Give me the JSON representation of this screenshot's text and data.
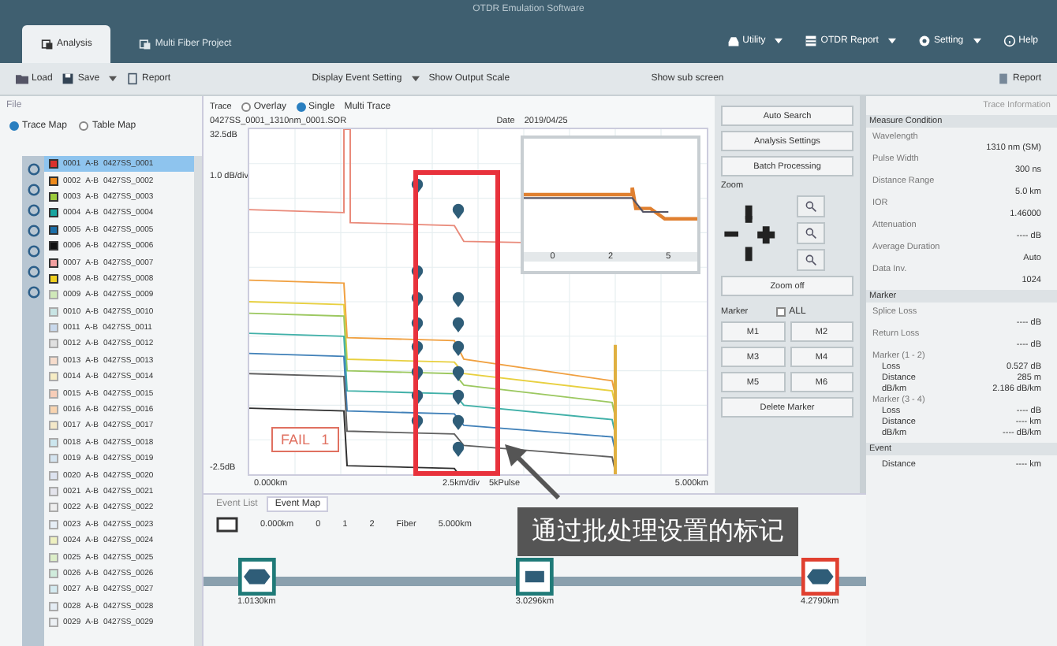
{
  "window": {
    "title": "OTDR Emulation Software"
  },
  "ribbon_tabs": [
    {
      "label": "Analysis",
      "selected": true
    },
    {
      "label": "Multi Fiber Project",
      "selected": false
    }
  ],
  "ribbon_buttons": [
    {
      "label": "Utility",
      "kind": "drive"
    },
    {
      "label": "OTDR Report",
      "kind": "table"
    },
    {
      "label": "Setting",
      "kind": "gear"
    },
    {
      "label": "Help",
      "kind": "help"
    }
  ],
  "toolbar": {
    "load": "Load",
    "save": "Save",
    "report": "Report",
    "display": "Display Event Setting",
    "scale": "Show Output Scale",
    "sub": "Show sub screen",
    "report_right": "Report"
  },
  "left_panel": {
    "title": "File",
    "modes": [
      {
        "label": "Trace Map",
        "selected": true
      },
      {
        "label": "Table Map",
        "selected": false
      }
    ],
    "files": [
      {
        "num": "0001",
        "dir": "A-B",
        "name": "0427SS_0001",
        "color": "#d9302c",
        "checked": true,
        "selected": true
      },
      {
        "num": "0002",
        "dir": "A-B",
        "name": "0427SS_0002",
        "color": "#ee8a1c",
        "checked": true,
        "selected": false
      },
      {
        "num": "0003",
        "dir": "A-B",
        "name": "0427SS_0003",
        "color": "#9ccc3c",
        "checked": true,
        "selected": false
      },
      {
        "num": "0004",
        "dir": "A-B",
        "name": "0427SS_0004",
        "color": "#1aa5a0",
        "checked": true,
        "selected": false
      },
      {
        "num": "0005",
        "dir": "A-B",
        "name": "0427SS_0005",
        "color": "#1c6fa8",
        "checked": true,
        "selected": false
      },
      {
        "num": "0006",
        "dir": "A-B",
        "name": "0427SS_0006",
        "color": "#111111",
        "checked": true,
        "selected": false
      },
      {
        "num": "0007",
        "dir": "A-B",
        "name": "0427SS_0007",
        "color": "#f2a0a0",
        "checked": true,
        "selected": false
      },
      {
        "num": "0008",
        "dir": "A-B",
        "name": "0427SS_0008",
        "color": "#f0d020",
        "checked": true,
        "selected": false
      },
      {
        "num": "0009",
        "dir": "A-B",
        "name": "0427SS_0009",
        "color": "#cfe8b8",
        "checked": false,
        "selected": false
      },
      {
        "num": "0010",
        "dir": "A-B",
        "name": "0427SS_0010",
        "color": "#c8e4e4",
        "checked": false,
        "selected": false
      },
      {
        "num": "0011",
        "dir": "A-B",
        "name": "0427SS_0011",
        "color": "#c8d8ec",
        "checked": false,
        "selected": false
      },
      {
        "num": "0012",
        "dir": "A-B",
        "name": "0427SS_0012",
        "color": "#e0e0e0",
        "checked": false,
        "selected": false
      },
      {
        "num": "0013",
        "dir": "A-B",
        "name": "0427SS_0013",
        "color": "#f6dccc",
        "checked": false,
        "selected": false
      },
      {
        "num": "0014",
        "dir": "A-B",
        "name": "0427SS_0014",
        "color": "#f6ecc4",
        "checked": false,
        "selected": false
      },
      {
        "num": "0015",
        "dir": "A-B",
        "name": "0427SS_0015",
        "color": "#f7cdb8",
        "checked": false,
        "selected": false
      },
      {
        "num": "0016",
        "dir": "A-B",
        "name": "0427SS_0016",
        "color": "#f8d4b0",
        "checked": false,
        "selected": false
      },
      {
        "num": "0017",
        "dir": "A-B",
        "name": "0427SS_0017",
        "color": "#f4e8c8",
        "checked": false,
        "selected": false
      },
      {
        "num": "0018",
        "dir": "A-B",
        "name": "0427SS_0018",
        "color": "#cce6ee",
        "checked": false,
        "selected": false
      },
      {
        "num": "0019",
        "dir": "A-B",
        "name": "0427SS_0019",
        "color": "#d4e4f0",
        "checked": false,
        "selected": false
      },
      {
        "num": "0020",
        "dir": "A-B",
        "name": "0427SS_0020",
        "color": "#dde3f0",
        "checked": false,
        "selected": false
      },
      {
        "num": "0021",
        "dir": "A-B",
        "name": "0427SS_0021",
        "color": "#e4e4ec",
        "checked": false,
        "selected": false
      },
      {
        "num": "0022",
        "dir": "A-B",
        "name": "0427SS_0022",
        "color": "#eeeeee",
        "checked": false,
        "selected": false
      },
      {
        "num": "0023",
        "dir": "A-B",
        "name": "0427SS_0023",
        "color": "#e6eef6",
        "checked": false,
        "selected": false
      },
      {
        "num": "0024",
        "dir": "A-B",
        "name": "0427SS_0024",
        "color": "#eef0c0",
        "checked": false,
        "selected": false
      },
      {
        "num": "0025",
        "dir": "A-B",
        "name": "0427SS_0025",
        "color": "#dceec8",
        "checked": false,
        "selected": false
      },
      {
        "num": "0026",
        "dir": "A-B",
        "name": "0427SS_0026",
        "color": "#d0ecdc",
        "checked": false,
        "selected": false
      },
      {
        "num": "0027",
        "dir": "A-B",
        "name": "0427SS_0027",
        "color": "#d4eaf0",
        "checked": false,
        "selected": false
      },
      {
        "num": "0028",
        "dir": "A-B",
        "name": "0427SS_0028",
        "color": "#e4ecf4",
        "checked": false,
        "selected": false
      },
      {
        "num": "0029",
        "dir": "A-B",
        "name": "0427SS_0029",
        "color": "#ecf0f4",
        "checked": false,
        "selected": false
      }
    ]
  },
  "trace_panel": {
    "label": "Trace",
    "views": [
      {
        "label": "Overlay",
        "selected": false
      },
      {
        "label": "Single",
        "selected": true
      }
    ],
    "multi": "Multi Trace",
    "file": "0427SS_0001_1310nm_0001.SOR",
    "date_label": "Date",
    "date": "2019/04/25",
    "y_top": "32.5dB",
    "y_div": "1.0 dB/div",
    "y_bottom": "-2.5dB",
    "x_left": "0.000km",
    "x_mid": "2.5km/div",
    "x_mid2": "5kPulse",
    "x_right": "5.000km",
    "fail": "FAIL   1",
    "inset_ticks": [
      "0",
      "2",
      "5"
    ]
  },
  "buttons_panel": {
    "top": [
      "Auto Search",
      "Analysis Settings",
      "Batch Processing"
    ],
    "zoom_label": "Zoom",
    "zoom_off": "Zoom off",
    "marker_label": "Marker",
    "all": {
      "label": "ALL",
      "checked": false
    },
    "markers": [
      "M1",
      "M2",
      "M3",
      "M4",
      "M5",
      "M6"
    ],
    "delete": "Delete Marker"
  },
  "properties": {
    "title": "Trace Information",
    "section": "Measure Condition",
    "items": [
      {
        "label": "Wavelength",
        "value": "1310 nm (SM)"
      },
      {
        "label": "Pulse Width",
        "value": "300 ns"
      },
      {
        "label": "Distance Range",
        "value": "5.0 km"
      },
      {
        "label": "IOR",
        "value": "1.46000"
      },
      {
        "label": "Attenuation",
        "value": "---- dB"
      },
      {
        "label": "Average Duration",
        "value": "Auto"
      },
      {
        "label": "Data Inv.",
        "value": "1024"
      }
    ],
    "marker_section": "Marker",
    "marker_items": [
      {
        "label": "Splice Loss",
        "value": "---- dB"
      },
      {
        "label": "Return Loss",
        "value": "---- dB"
      },
      {
        "label": "Marker (1 - 2)",
        "value": ""
      }
    ],
    "m12": [
      {
        "label": "Loss",
        "value": "0.527 dB"
      },
      {
        "label": "Distance",
        "value": "285 m"
      },
      {
        "label": "dB/km",
        "value": "2.186 dB/km"
      }
    ],
    "m34_label": "Marker (3 - 4)",
    "m34": [
      {
        "label": "Loss",
        "value": "---- dB"
      },
      {
        "label": "Distance",
        "value": "---- km"
      },
      {
        "label": "dB/km",
        "value": "---- dB/km"
      }
    ],
    "event_section": "Event",
    "event_items": [
      {
        "label": "Distance",
        "value": "---- km"
      }
    ]
  },
  "bottom": {
    "tabs": [
      {
        "label": "Event List",
        "selected": false
      },
      {
        "label": "Event Map",
        "selected": true
      }
    ],
    "scale_label": "0.000km",
    "scale": [
      "0",
      "1",
      "2"
    ],
    "fiber_label": "Fiber",
    "end_label": "5.000km",
    "events": [
      {
        "distance": "1.0130km",
        "fail": false,
        "kind": "splice"
      },
      {
        "distance": "3.0296km",
        "fail": false,
        "kind": "connector"
      },
      {
        "distance": "4.2790km",
        "fail": true,
        "kind": "splice"
      }
    ]
  },
  "callout": {
    "text": "通过批处理设置的标记"
  }
}
